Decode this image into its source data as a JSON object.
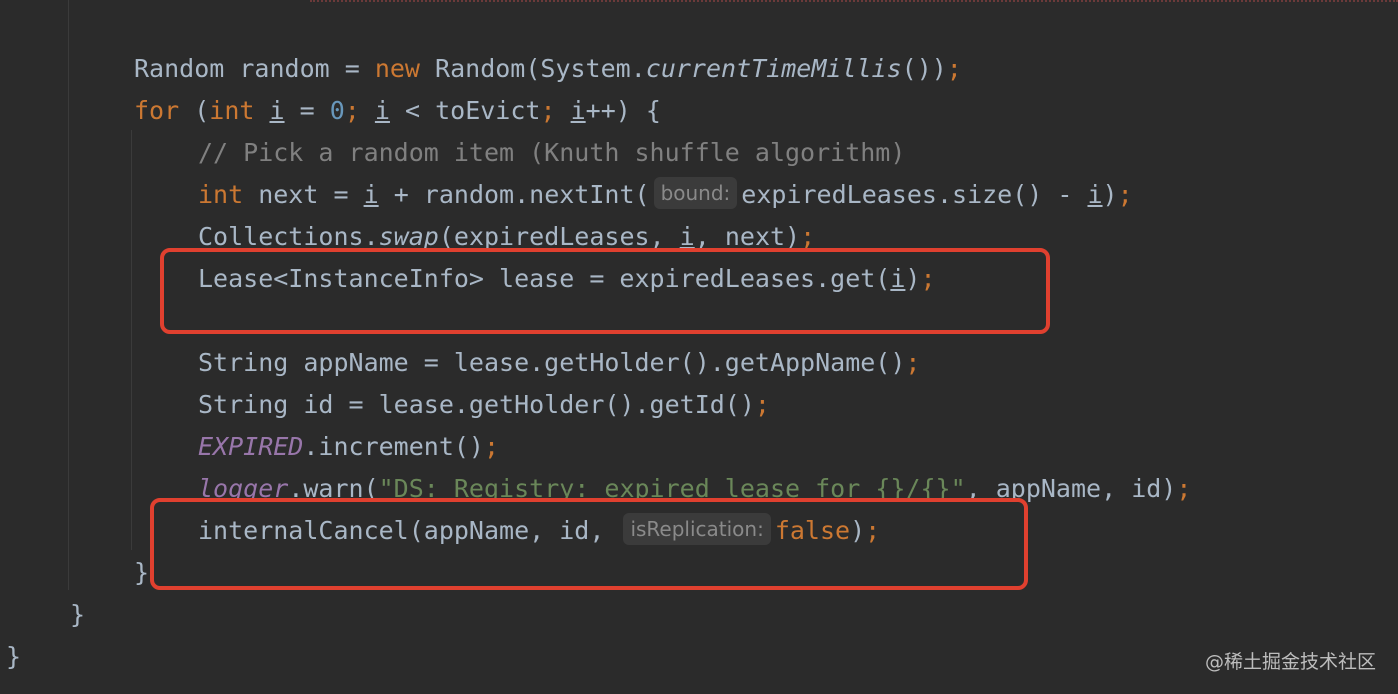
{
  "code": {
    "l1": {
      "t1": "Random random = ",
      "kw_new": "new",
      "t2": " Random(System.",
      "method": "currentTimeMillis",
      "t3": "())",
      "semi": ";"
    },
    "l2": {
      "kw_for": "for",
      "t1": " (",
      "kw_int": "int",
      "t2": " ",
      "var": "i",
      "t3": " = ",
      "num": "0",
      "semi1": ";",
      "t4": " ",
      "var2": "i",
      "t5": " < toEvict",
      "semi2": ";",
      "t6": " ",
      "var3": "i",
      "t7": "++) {"
    },
    "l3": {
      "comment": "// Pick a random item (Knuth shuffle algorithm)"
    },
    "l4": {
      "kw_int": "int",
      "t1": " next = ",
      "var": "i",
      "t2": " + random.nextInt(",
      "hint": "bound:",
      "t3": "expiredLeases.size() - ",
      "var2": "i",
      "t4": ")",
      "semi": ";"
    },
    "l5": {
      "t1": "Collections.",
      "method": "swap",
      "t2": "(expiredLeases, ",
      "var": "i",
      "t3": ", next)",
      "semi": ";"
    },
    "l6": {
      "t1": "Lease<InstanceInfo> lease = expiredLeases.get(",
      "var": "i",
      "t2": ")",
      "semi": ";"
    },
    "l7": {
      "t1": "String appName = lease.getHolder().getAppName()",
      "semi": ";"
    },
    "l8": {
      "t1": "String id = lease.getHolder().getId()",
      "semi": ";"
    },
    "l9": {
      "field": "EXPIRED",
      "t1": ".increment()",
      "semi": ";"
    },
    "l10": {
      "field": "logger",
      "t1": ".warn(",
      "str": "\"DS: Registry: expired lease for {}/{}\"",
      "t2": ", appName, id)",
      "semi": ";"
    },
    "l11": {
      "t1": "internalCancel(appName, id, ",
      "hint": "isReplication:",
      "kw_false": "false",
      "t2": ")",
      "semi": ";"
    },
    "l12": {
      "t1": "}"
    },
    "l13": {
      "t1": "}"
    },
    "l14": {
      "t1": "}"
    }
  },
  "watermark": "@稀土掘金技术社区",
  "colors": {
    "background": "#2b2b2b",
    "keyword": "#cc7832",
    "text": "#a9b7c6",
    "number": "#6897bb",
    "comment": "#808080",
    "field": "#9876aa",
    "string": "#6a8759",
    "highlight": "#e0402f"
  }
}
